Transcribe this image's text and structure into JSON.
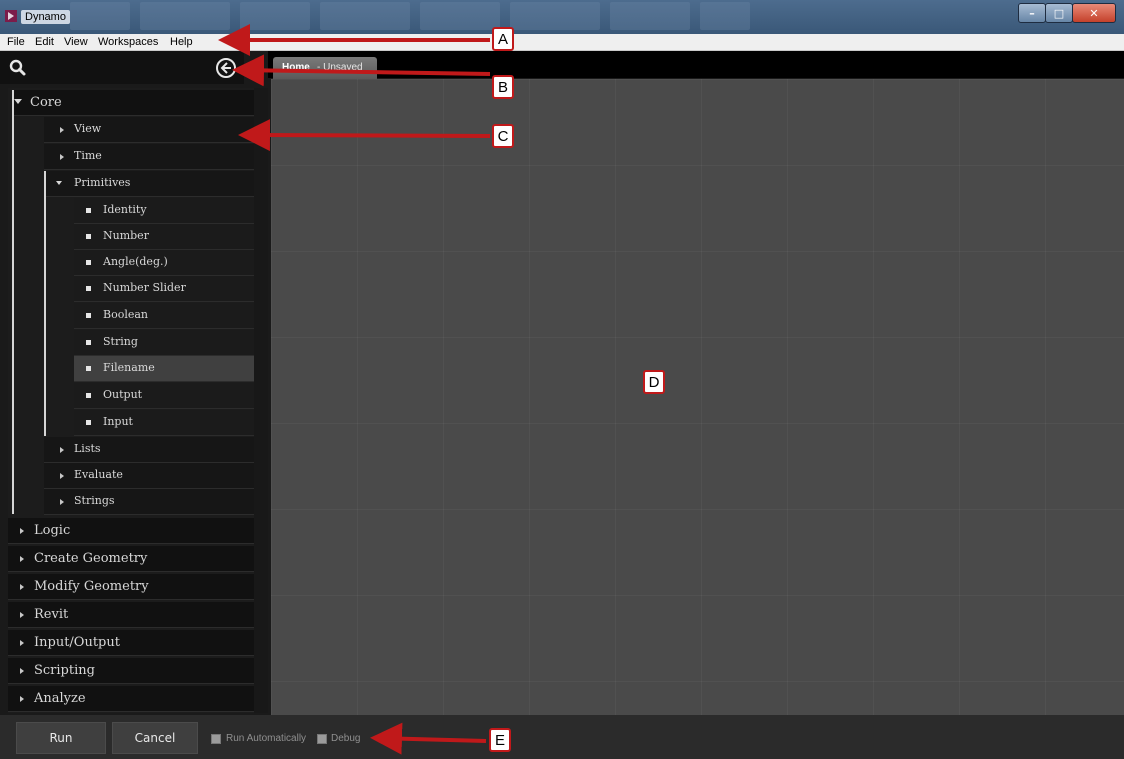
{
  "window": {
    "title": "Dynamo",
    "controls": [
      "minimize-icon",
      "maximize-icon",
      "close-icon"
    ]
  },
  "menu": {
    "items": [
      "File",
      "Edit",
      "View",
      "Workspaces",
      "Help"
    ]
  },
  "search": {
    "placeholder": ""
  },
  "tabs": [
    {
      "name": "Home",
      "status": "- Unsaved"
    }
  ],
  "library": {
    "core": {
      "label": "Core",
      "children": [
        "View",
        "Time",
        "Primitives",
        "Lists",
        "Evaluate",
        "Strings"
      ],
      "primitives": [
        "Identity",
        "Number",
        "Angle(deg.)",
        "Number Slider",
        "Boolean",
        "String",
        "Filename",
        "Output",
        "Input"
      ],
      "selected": "Filename"
    },
    "categories": [
      "Logic",
      "Create Geometry",
      "Modify Geometry",
      "Revit",
      "Input/Output",
      "Scripting",
      "Analyze"
    ]
  },
  "bottom": {
    "run": "Run",
    "cancel": "Cancel",
    "run_auto": "Run Automatically",
    "debug": "Debug"
  },
  "annotations": [
    "A",
    "B",
    "C",
    "D",
    "E"
  ],
  "colors": {
    "callout_red": "#c0191a",
    "canvas": "#4a4a4a"
  }
}
